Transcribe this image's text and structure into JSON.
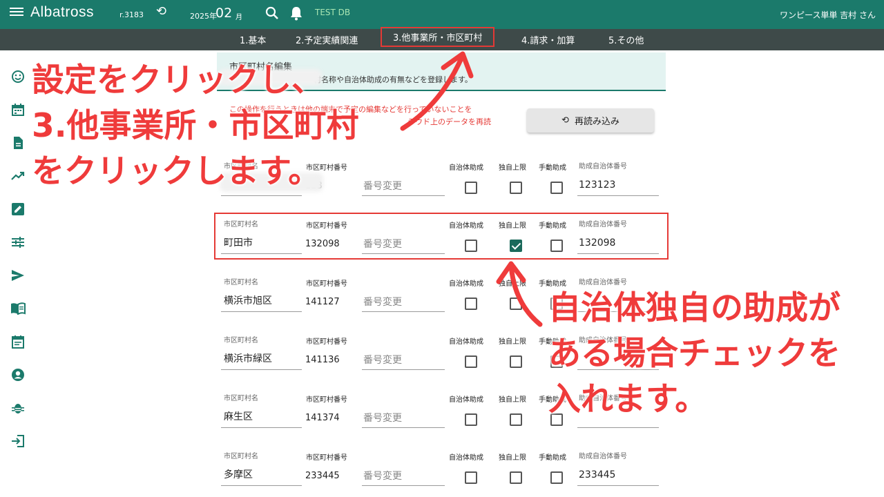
{
  "app": {
    "title": "Albatross",
    "revision": "r.3183",
    "year": "2025年",
    "month": "02",
    "month_suffix": "月",
    "db_name": "TEST DB",
    "user": "ワンピース単単 吉村 さん"
  },
  "tabs": [
    {
      "label": "1.基本"
    },
    {
      "label": "2.予定実績関連"
    },
    {
      "label": "3.他事業所・市区町村"
    },
    {
      "label": "4.請求・加算"
    },
    {
      "label": "5.その他"
    }
  ],
  "sidebar": {
    "icons": [
      "smiley-icon",
      "calendar-icon",
      "document-icon",
      "trending-up-icon",
      "edit-icon",
      "sliders-icon",
      "send-icon",
      "book-icon",
      "event-note-icon",
      "account-circle-icon",
      "bug-icon",
      "login-icon"
    ]
  },
  "panel": {
    "title": "市区町村名編集",
    "description": "村名称や自治体助成の有無などを登録します。"
  },
  "warning": {
    "line1": "この操作を行うときは他の端末で予定の編集などを行っていないことを",
    "line2": "ラウド上のデータを再読"
  },
  "reload_button": {
    "label": "再読み込み"
  },
  "labels": {
    "name": "市区町村名",
    "number": "市区町村番号",
    "change": "番号変更",
    "muni_subsidy": "自治体助成",
    "own_limit": "独自上限",
    "manual_subsidy": "手動助成",
    "subsidy_number": "助成自治体番号"
  },
  "rows": [
    {
      "name": "",
      "number": "123",
      "muni_subsidy": false,
      "own_limit": false,
      "manual_subsidy": false,
      "subsidy_number": "123123"
    },
    {
      "name": "町田市",
      "number": "132098",
      "muni_subsidy": false,
      "own_limit": true,
      "manual_subsidy": false,
      "subsidy_number": "132098"
    },
    {
      "name": "横浜市旭区",
      "number": "141127",
      "muni_subsidy": false,
      "own_limit": false,
      "manual_subsidy": false,
      "subsidy_number": ""
    },
    {
      "name": "横浜市緑区",
      "number": "141136",
      "muni_subsidy": false,
      "own_limit": false,
      "manual_subsidy": false,
      "subsidy_number": ""
    },
    {
      "name": "麻生区",
      "number": "141374",
      "muni_subsidy": false,
      "own_limit": false,
      "manual_subsidy": false,
      "subsidy_number": ""
    },
    {
      "name": "多摩区",
      "number": "233445",
      "muni_subsidy": false,
      "own_limit": false,
      "manual_subsidy": false,
      "subsidy_number": "233445"
    }
  ],
  "annotations": {
    "left": [
      "設定をクリックし、",
      "3.他事業所・市区町村",
      "をクリックします。"
    ],
    "right": [
      "自治体独自の助成が",
      "ある場合チェックを",
      "入れます。"
    ]
  },
  "colors": {
    "header": "#1b7a6b",
    "tabs_bar": "#3e4a49",
    "accent_red": "#e53935",
    "checkbox_checked": "#1b6a5b"
  }
}
